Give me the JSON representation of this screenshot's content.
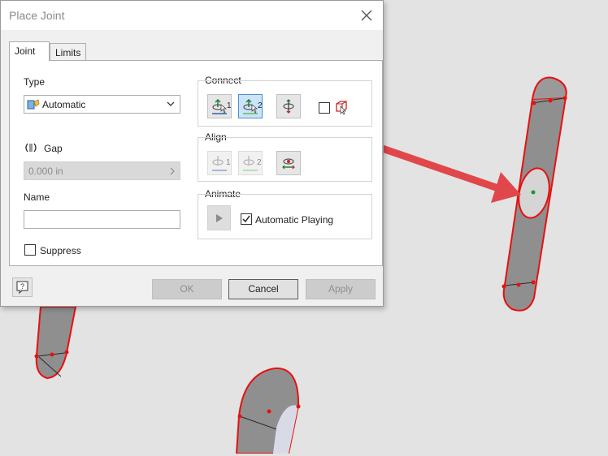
{
  "dialog": {
    "title": "Place Joint",
    "tabs": [
      {
        "label": "Joint",
        "active": true
      },
      {
        "label": "Limits",
        "active": false
      }
    ],
    "type_label": "Type",
    "type_value": "Automatic",
    "gap_label": "Gap",
    "gap_value": "0.000 in",
    "name_label": "Name",
    "name_value": "",
    "suppress_label": "Suppress",
    "suppress_checked": false,
    "connect_label": "Connect",
    "connect_btn1_num": "1",
    "connect_btn2_num": "2",
    "align_label": "Align",
    "align_btn1_num": "1",
    "align_btn2_num": "2",
    "animate_label": "Animate",
    "automatic_playing_label": "Automatic Playing",
    "automatic_playing_checked": true,
    "ok_label": "OK",
    "cancel_label": "Cancel",
    "apply_label": "Apply"
  },
  "colors": {
    "highlight": "#e81010",
    "arrow": "#e0474b",
    "part_fill": "#8f8f8f",
    "viewport_bg": "#e3e3e3",
    "selected_button": "#cce4f7"
  },
  "icons": {
    "close": "close-icon",
    "type": "automatic-joint-type-icon",
    "gap": "gap-icon",
    "connect1": "connect-origin-1-icon",
    "connect2": "connect-origin-2-icon",
    "flip": "flip-component-icon",
    "cube": "component-select-icon",
    "play": "play-icon",
    "help": "help-icon"
  }
}
